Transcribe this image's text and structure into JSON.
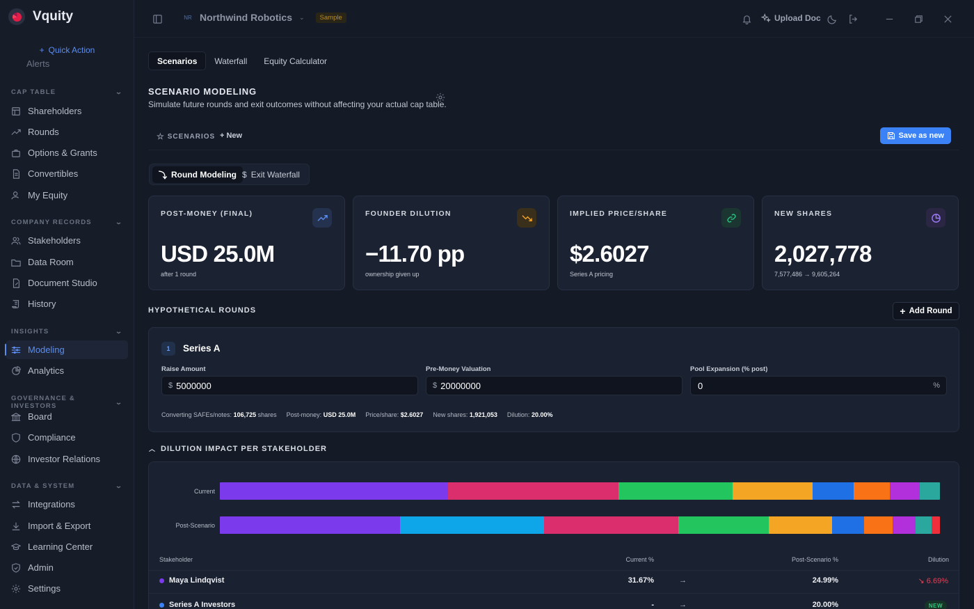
{
  "app": {
    "name": "Vquity"
  },
  "sidebar": {
    "quick_action": "Quick Action",
    "alerts_label": "Alerts",
    "sections": [
      {
        "title": "CAP TABLE",
        "items": [
          "Shareholders",
          "Rounds",
          "Options & Grants",
          "Convertibles",
          "My Equity"
        ]
      },
      {
        "title": "COMPANY RECORDS",
        "items": [
          "Stakeholders",
          "Data Room",
          "Document Studio",
          "History"
        ]
      },
      {
        "title": "INSIGHTS",
        "items": [
          "Modeling",
          "Analytics"
        ]
      },
      {
        "title": "GOVERNANCE & INVESTORS",
        "items": [
          "Board",
          "Compliance",
          "Investor Relations"
        ]
      },
      {
        "title": "DATA & SYSTEM",
        "items": [
          "Integrations",
          "Import & Export",
          "Learning Center",
          "Admin",
          "Settings"
        ]
      }
    ],
    "active_item": "Modeling"
  },
  "topbar": {
    "company_initials": "NR",
    "company_name": "Northwind Robotics",
    "sample_badge": "Sample",
    "upload_label": "Upload Doc"
  },
  "tabs": [
    "Scenarios",
    "Waterfall",
    "Equity Calculator"
  ],
  "active_tab": "Scenarios",
  "page": {
    "title": "SCENARIO MODELING",
    "subtitle": "Simulate future rounds and exit outcomes without affecting your actual cap table."
  },
  "scenarios_bar": {
    "label": "SCENARIOS",
    "new_label": "New",
    "save_label": "Save as new"
  },
  "modes": [
    "Round Modeling",
    "Exit Waterfall"
  ],
  "active_mode": "Round Modeling",
  "kpis": [
    {
      "label": "POST-MONEY (FINAL)",
      "value": "USD 25.0M",
      "sub": "after 1 round",
      "icon": "trending-up-icon",
      "color": "#5b8def"
    },
    {
      "label": "FOUNDER DILUTION",
      "value": "−11.70 pp",
      "sub": "ownership given up",
      "icon": "trending-down-icon",
      "color": "#f5a524"
    },
    {
      "label": "IMPLIED PRICE/SHARE",
      "value": "$2.6027",
      "sub": "Series A pricing",
      "icon": "link-icon",
      "color": "#2fbf83"
    },
    {
      "label": "NEW SHARES",
      "value": "2,027,778",
      "sub": "7,577,486 → 9,605,264",
      "icon": "pie-chart-icon",
      "color": "#9b7cf6"
    }
  ],
  "hypothetical": {
    "title": "HYPOTHETICAL ROUNDS",
    "add_label": "Add Round"
  },
  "round": {
    "number": "1",
    "name": "Series A",
    "raise_label": "Raise Amount",
    "raise_prefix": "$",
    "raise_value": "5000000",
    "premoney_label": "Pre-Money Valuation",
    "premoney_prefix": "$",
    "premoney_value": "20000000",
    "pool_label": "Pool Expansion (% post)",
    "pool_value": "0",
    "pool_suffix": "%",
    "stats": [
      {
        "label": "Converting SAFEs/notes:",
        "value": "106,725",
        "tail": "shares"
      },
      {
        "label": "Post-money:",
        "value": "USD 25.0M",
        "tail": ""
      },
      {
        "label": "Price/share:",
        "value": "$2.6027",
        "tail": ""
      },
      {
        "label": "New shares:",
        "value": "1,921,053",
        "tail": ""
      },
      {
        "label": "Dilution:",
        "value": "20.00%",
        "tail": ""
      }
    ]
  },
  "dilution": {
    "title": "DILUTION IMPACT PER STAKEHOLDER",
    "bars": [
      {
        "label": "Current",
        "segments": [
          {
            "color": "#7c3aed",
            "pct": 31.67
          },
          {
            "color": "#db2f6d",
            "pct": 23.7
          },
          {
            "color": "#22c55e",
            "pct": 15.8
          },
          {
            "color": "#f5a524",
            "pct": 11.2
          },
          {
            "color": "#1f6fe5",
            "pct": 5.7
          },
          {
            "color": "#f97316",
            "pct": 5.0
          },
          {
            "color": "#b22fdc",
            "pct": 4.1
          },
          {
            "color": "#2ba89d",
            "pct": 2.83
          }
        ]
      },
      {
        "label": "Post-Scenario",
        "segments": [
          {
            "color": "#7c3aed",
            "pct": 24.99
          },
          {
            "color": "#0ea5e9",
            "pct": 20.0
          },
          {
            "color": "#db2f6d",
            "pct": 18.7
          },
          {
            "color": "#22c55e",
            "pct": 12.5
          },
          {
            "color": "#f5a524",
            "pct": 8.8
          },
          {
            "color": "#1f6fe5",
            "pct": 4.5
          },
          {
            "color": "#f97316",
            "pct": 3.9
          },
          {
            "color": "#b22fdc",
            "pct": 3.2
          },
          {
            "color": "#2ba89d",
            "pct": 2.3
          },
          {
            "color": "#ef2f3c",
            "pct": 1.11
          }
        ]
      }
    ],
    "columns": {
      "stakeholder": "Stakeholder",
      "current": "Current %",
      "post": "Post-Scenario %",
      "dilution": "Dilution"
    },
    "rows": [
      {
        "name": "Maya Lindqvist",
        "dot": "#7c3aed",
        "current": "31.67%",
        "arrow": "→",
        "post": "24.99%",
        "dilution": "↘ 6.69%"
      },
      {
        "name": "Series A Investors",
        "dot": "#1f6fe5",
        "current": "-",
        "arrow": "→",
        "post": "20.00%",
        "dilution": "NEW"
      }
    ]
  }
}
